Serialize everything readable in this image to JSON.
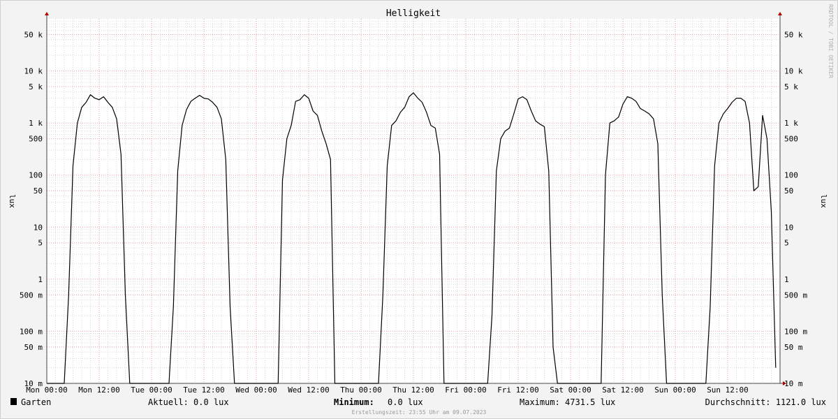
{
  "chart_data": {
    "type": "line",
    "title": "Helligkeit",
    "ylabel": "lux",
    "yscale": "log",
    "ylim": [
      0.01,
      100000
    ],
    "grid": true,
    "x_tick_labels": [
      "Mon 00:00",
      "Mon 12:00",
      "Tue 00:00",
      "Tue 12:00",
      "Wed 00:00",
      "Wed 12:00",
      "Thu 00:00",
      "Thu 12:00",
      "Fri 00:00",
      "Fri 12:00",
      "Sat 00:00",
      "Sat 12:00",
      "Sun 00:00",
      "Sun 12:00"
    ],
    "y_ticks": [
      {
        "value": 0.01,
        "label": "10 m"
      },
      {
        "value": 0.05,
        "label": "50 m"
      },
      {
        "value": 0.1,
        "label": "100 m"
      },
      {
        "value": 0.5,
        "label": "500 m"
      },
      {
        "value": 1,
        "label": "1"
      },
      {
        "value": 5,
        "label": "5"
      },
      {
        "value": 10,
        "label": "10"
      },
      {
        "value": 50,
        "label": "50"
      },
      {
        "value": 100,
        "label": "100"
      },
      {
        "value": 500,
        "label": "500"
      },
      {
        "value": 1000,
        "label": "1 k"
      },
      {
        "value": 5000,
        "label": "5 k"
      },
      {
        "value": 10000,
        "label": "10 k"
      },
      {
        "value": 50000,
        "label": "50 k"
      }
    ],
    "series": [
      {
        "name": "Garten",
        "color": "#000000",
        "x_hours": [
          0,
          1,
          2,
          3,
          4,
          5,
          6,
          7,
          8,
          9,
          10,
          11,
          12,
          13,
          14,
          15,
          16,
          17,
          18,
          19,
          20,
          21,
          22,
          23,
          24,
          25,
          26,
          27,
          28,
          29,
          30,
          31,
          32,
          33,
          34,
          35,
          36,
          37,
          38,
          39,
          40,
          41,
          42,
          43,
          44,
          45,
          46,
          47,
          48,
          49,
          50,
          51,
          52,
          53,
          54,
          55,
          56,
          57,
          58,
          59,
          60,
          61,
          62,
          63,
          64,
          65,
          66,
          67,
          68,
          69,
          70,
          71,
          72,
          73,
          74,
          75,
          76,
          77,
          78,
          79,
          80,
          81,
          82,
          83,
          84,
          85,
          86,
          87,
          88,
          89,
          90,
          91,
          92,
          93,
          94,
          95,
          96,
          97,
          98,
          99,
          100,
          101,
          102,
          103,
          104,
          105,
          106,
          107,
          108,
          109,
          110,
          111,
          112,
          113,
          114,
          115,
          116,
          117,
          118,
          119,
          120,
          121,
          122,
          123,
          124,
          125,
          126,
          127,
          128,
          129,
          130,
          131,
          132,
          133,
          134,
          135,
          136,
          137,
          138,
          139,
          140,
          141,
          142,
          143,
          144,
          145,
          146,
          147,
          148,
          149,
          150,
          151,
          152,
          153,
          154,
          155,
          156,
          157,
          158,
          159,
          160,
          161,
          162,
          163,
          164,
          165,
          166,
          167
        ],
        "lux": [
          0.01,
          0.01,
          0.01,
          0.01,
          0.01,
          0.5,
          150,
          1000,
          2000,
          2500,
          3500,
          3000,
          2800,
          3200,
          2500,
          2000,
          1200,
          250,
          0.5,
          0.01,
          0.01,
          0.01,
          0.01,
          0.01,
          0.01,
          0.01,
          0.01,
          0.01,
          0.01,
          0.3,
          120,
          900,
          1800,
          2600,
          3000,
          3400,
          3000,
          2900,
          2500,
          2000,
          1200,
          200,
          0.3,
          0.01,
          0.01,
          0.01,
          0.01,
          0.01,
          0.01,
          0.01,
          0.01,
          0.01,
          0.01,
          0.01,
          80,
          500,
          900,
          2600,
          2800,
          3500,
          3000,
          1700,
          1400,
          700,
          400,
          200,
          0.01,
          0.01,
          0.01,
          0.01,
          0.01,
          0.01,
          0.01,
          0.01,
          0.01,
          0.01,
          0.01,
          0.5,
          150,
          900,
          1100,
          1600,
          2000,
          3200,
          3800,
          3000,
          2500,
          1600,
          900,
          800,
          250,
          0.01,
          0.01,
          0.01,
          0.01,
          0.01,
          0.01,
          0.01,
          0.01,
          0.01,
          0.01,
          0.01,
          0.2,
          120,
          500,
          700,
          800,
          1500,
          2900,
          3200,
          2800,
          1700,
          1100,
          950,
          850,
          120,
          0.05,
          0.01,
          0.01,
          0.01,
          0.01,
          0.01,
          0.01,
          0.01,
          0.01,
          0.01,
          0.01,
          0.01,
          100,
          1000,
          1100,
          1300,
          2300,
          3200,
          3000,
          2600,
          1900,
          1700,
          1500,
          1200,
          400,
          0.5,
          0.01,
          0.01,
          0.01,
          0.01,
          0.01,
          0.01,
          0.01,
          0.01,
          0.01,
          0.01,
          0.3,
          150,
          1000,
          1500,
          1900,
          2500,
          3000,
          3000,
          2600,
          1000,
          50,
          60,
          1400,
          500,
          20,
          0.02,
          0.01
        ]
      }
    ],
    "legend": {
      "series_label": "Garten",
      "aktuell": "Aktuell:    0.0 lux",
      "minimum_label": "Minimum:",
      "minimum_value": "0.0 lux",
      "maximum": "Maximum: 4731.5 lux",
      "durchschnitt": "Durchschnitt: 1121.0 lux"
    },
    "footer": "Erstellungszeit: 23:55 Uhr am 09.07.2023",
    "watermark": "RRDTOOL / TOBI OETIKER",
    "colors": {
      "grid_minor": "#d9d9d9",
      "grid_major": "#e6a0a0",
      "axis_arrow": "#b00000",
      "plot_bg": "#ffffff"
    }
  }
}
